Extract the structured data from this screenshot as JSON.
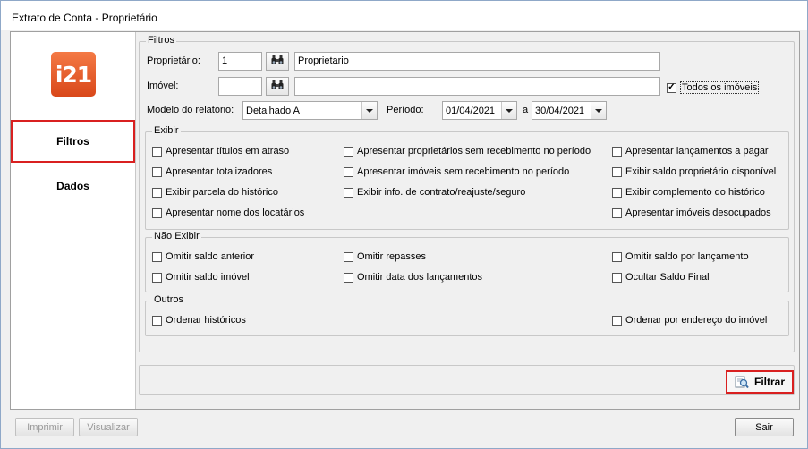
{
  "window": {
    "title": "Extrato de Conta - Proprietário"
  },
  "sidebar": {
    "logo_text": "i21",
    "items": [
      {
        "label": "Filtros",
        "active": true
      },
      {
        "label": "Dados",
        "active": false
      }
    ]
  },
  "filtros": {
    "group_title": "Filtros",
    "proprietario": {
      "label": "Proprietário:",
      "code": "1",
      "name": "Proprietario"
    },
    "imovel": {
      "label": "Imóvel:",
      "code": "",
      "name": "",
      "todos_label": "Todos os imóveis",
      "todos_checked": true
    },
    "modelo": {
      "label": "Modelo do relatório:",
      "value": "Detalhado A"
    },
    "periodo": {
      "label": "Período:",
      "start": "01/04/2021",
      "sep": "a",
      "end": "30/04/2021"
    }
  },
  "exibir": {
    "title": "Exibir",
    "options": [
      "Apresentar títulos em atraso",
      "Apresentar proprietários sem recebimento no período",
      "Apresentar lançamentos a pagar",
      "Apresentar totalizadores",
      "Apresentar imóveis sem recebimento no período",
      "Exibir saldo proprietário disponível",
      "Exibir parcela do histórico",
      "Exibir info. de contrato/reajuste/seguro",
      "Exibir complemento do histórico",
      "Apresentar nome dos locatários",
      "Apresentar imóveis desocupados"
    ]
  },
  "nao_exibir": {
    "title": "Não Exibir",
    "options": [
      "Omitir saldo anterior",
      "Omitir repasses",
      "Omitir saldo por lançamento",
      "Omitir saldo imóvel",
      "Omitir data dos lançamentos",
      "Ocultar Saldo Final"
    ]
  },
  "outros": {
    "title": "Outros",
    "options": [
      "Ordenar históricos",
      "Ordenar por endereço do imóvel"
    ]
  },
  "actions": {
    "filtrar": "Filtrar"
  },
  "footer": {
    "imprimir": "Imprimir",
    "visualizar": "Visualizar",
    "sair": "Sair"
  },
  "colors": {
    "accent_red": "#d92020",
    "logo_orange": "#e8582a"
  }
}
